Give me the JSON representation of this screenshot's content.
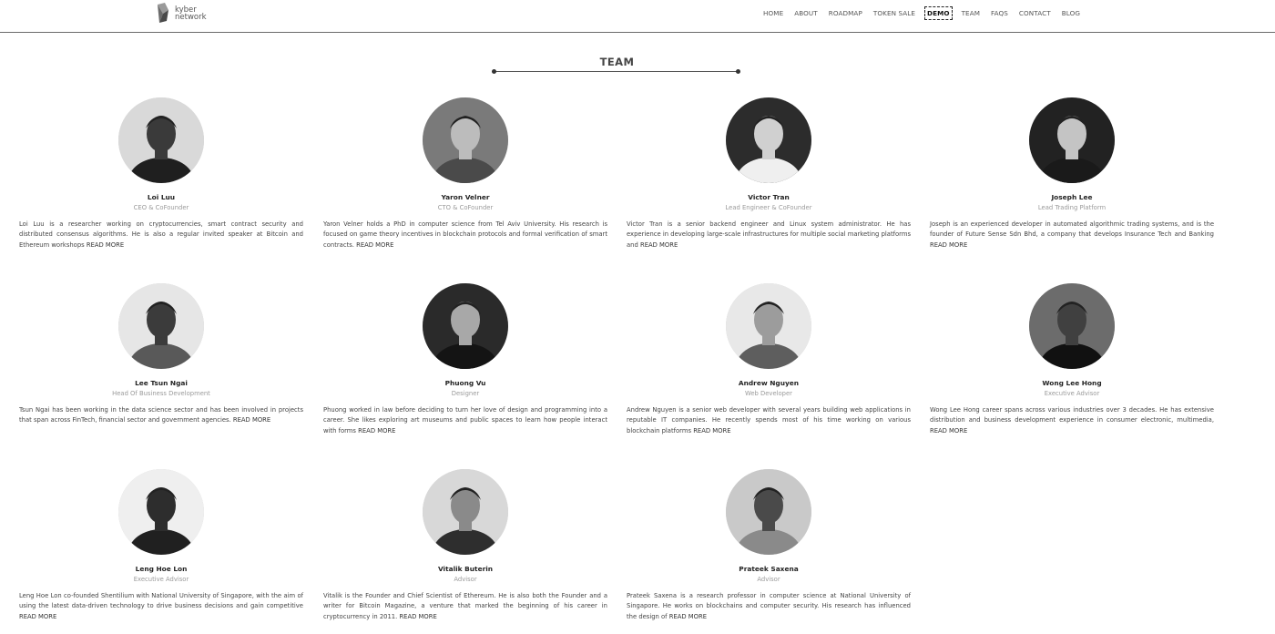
{
  "header": {
    "logo_text_line1": "kyber",
    "logo_text_line2": "network",
    "nav": [
      "HOME",
      "ABOUT",
      "ROADMAP",
      "TOKEN SALE",
      "DEMO",
      "TEAM",
      "FAQS",
      "CONTACT",
      "BLOG"
    ],
    "active_nav": "DEMO"
  },
  "section": {
    "title": "TEAM"
  },
  "read_more_label": "READ MORE",
  "members": [
    {
      "name": "Loi Luu",
      "role": "CEO & CoFounder",
      "bio": "Loi Luu is a researcher working on cryptocurrencies, smart contract security and distributed consensus algorithms. He is also a regular invited speaker at Bitcoin and Ethereum workshops"
    },
    {
      "name": "Yaron Velner",
      "role": "CTO & CoFounder",
      "bio": "Yaron Velner holds a PhD in computer science from Tel Aviv University. His research is focused on game theory incentives in blockchain protocols and formal verification of smart contracts."
    },
    {
      "name": "Victor Tran",
      "role": "Lead Engineer & CoFounder",
      "bio": "Victor Tran is a senior backend engineer and Linux system administrator. He has experience in developing large-scale infrastructures for multiple social marketing platforms and"
    },
    {
      "name": "Joseph Lee",
      "role": "Lead Trading Platform",
      "bio": "Joseph is an experienced developer in automated algorithmic trading systems, and is the founder of Future Sense Sdn Bhd, a company that develops Insurance Tech and Banking"
    },
    {
      "name": "Lee Tsun Ngai",
      "role": "Head Of Business Development",
      "bio": "Tsun Ngai has been working in the data science sector and has been involved in projects that span across FinTech, financial sector and government agencies."
    },
    {
      "name": "Phuong Vu",
      "role": "Designer",
      "bio": "Phuong worked in law before deciding to turn her love of design and programming into a career. She likes exploring art museums and public spaces to learn how people interact with forms"
    },
    {
      "name": "Andrew Nguyen",
      "role": "Web Developer",
      "bio": "Andrew Nguyen is a senior web developer with several years building web applications in reputable IT companies. He recently spends most of his time working on various blockchain platforms"
    },
    {
      "name": "Wong Lee Hong",
      "role": "Executive Advisor",
      "bio": "Wong Lee Hong career spans across various industries over 3 decades. He has extensive distribution and business development experience in consumer electronic, multimedia,"
    },
    {
      "name": "Leng Hoe Lon",
      "role": "Executive Advisor",
      "bio": "Leng Hoe Lon co-founded Shentilium with National University of Singapore, with the aim of using the latest data-driven technology to drive business decisions and gain competitive"
    },
    {
      "name": "Vitalik Buterin",
      "role": "Advisor",
      "bio": "Vitalik is the Founder and Chief Scientist of Ethereum. He is also both the Founder and a writer for Bitcoin Magazine, a venture that marked the beginning of his career in cryptocurrency in 2011."
    },
    {
      "name": "Prateek Saxena",
      "role": "Advisor",
      "bio": "Prateek Saxena is a research professor in computer science at National University of Singapore. He works on blockchains and computer security. His research has influenced the design of"
    }
  ]
}
